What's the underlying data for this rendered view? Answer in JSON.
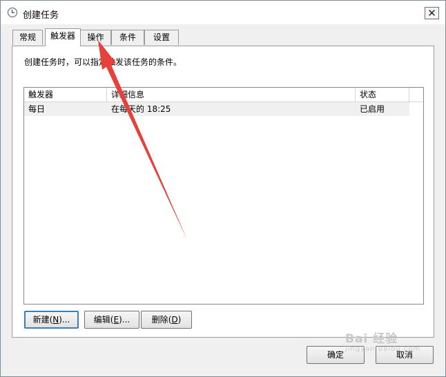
{
  "window": {
    "title": "创建任务",
    "close_label": "✕"
  },
  "tabs": [
    {
      "label": "常规"
    },
    {
      "label": "触发器"
    },
    {
      "label": "操作"
    },
    {
      "label": "条件"
    },
    {
      "label": "设置"
    }
  ],
  "triggers": {
    "description": "创建任务时，可以指定触发该任务的条件。",
    "columns": [
      "触发器",
      "详细信息",
      "状态"
    ],
    "rows": [
      {
        "trigger": "每日",
        "details": "在每天的 18:25",
        "status": "已启用"
      }
    ]
  },
  "buttons": {
    "new": {
      "label": "新建",
      "mnemonic": "N",
      "suffix": "..."
    },
    "edit": {
      "label": "编辑",
      "mnemonic": "E",
      "suffix": "..."
    },
    "delete": {
      "label": "删除",
      "mnemonic": "D",
      "suffix": ""
    },
    "ok": "确定",
    "cancel": "取消"
  },
  "watermark": {
    "logo": "Bai 经验",
    "url": "jingyan.baidu.com"
  },
  "colors": {
    "annotation_arrow": "#e8403a",
    "dialog_bg": "#f0f0f0"
  }
}
